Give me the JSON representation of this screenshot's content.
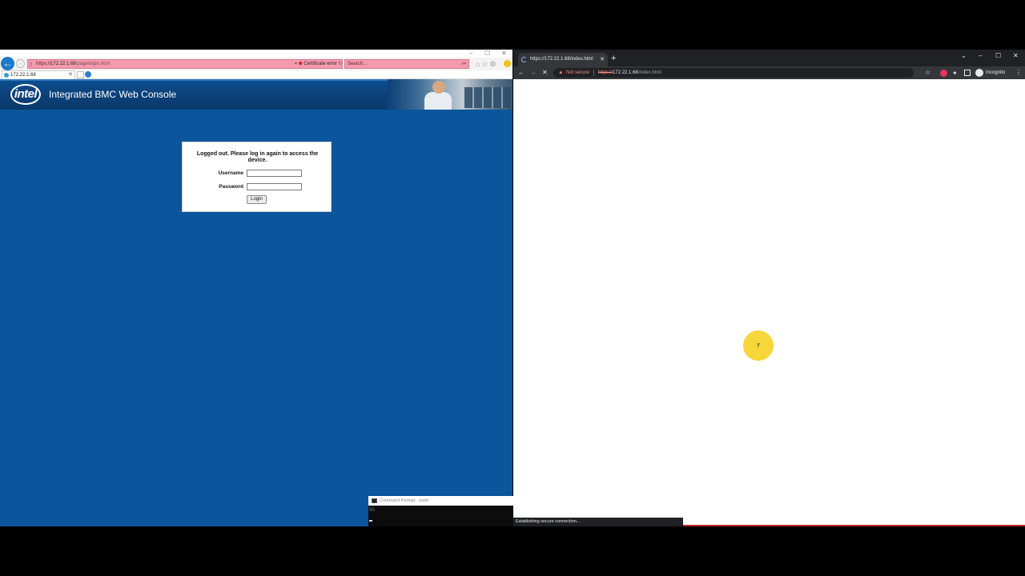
{
  "ie": {
    "url_host": "172.22.1.68",
    "url_scheme": "https://",
    "url_path": "/page/login.html",
    "cert_error": "Certificate error",
    "search_placeholder": "Search...",
    "tab_title": "172.22.1.68",
    "app_title": "Integrated BMC Web Console",
    "logo_text": "intel",
    "login": {
      "message": "Logged out. Please log in again to access the device.",
      "username_label": "Username",
      "password_label": "Password",
      "username_value": "",
      "password_value": "",
      "button_label": "Login"
    }
  },
  "cmd": {
    "title": "Command Prompt - bash",
    "line": "95"
  },
  "chrome": {
    "tab_title": "https://172.22.1.68/index.html",
    "security_label": "Not secure",
    "url_scheme": "https://",
    "url_host": "172.22.1.68",
    "url_path": "/index.html",
    "profile_label": "Incognito",
    "status_text": "Establishing secure connection..."
  },
  "colors": {
    "ie_page_bg": "#0a559b",
    "ie_url_error": "#f49aae",
    "chrome_dark": "#202124",
    "cursor_highlight": "#f5d228"
  }
}
